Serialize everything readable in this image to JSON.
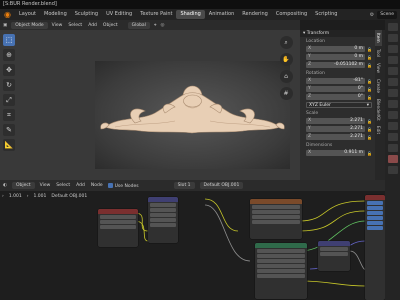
{
  "window": {
    "title": "[S:BUR Render.blend]"
  },
  "menubar": {
    "tabs": [
      "Layout",
      "Modeling",
      "Sculpting",
      "UV Editing",
      "Texture Paint",
      "Shading",
      "Animation",
      "Rendering",
      "Compositing",
      "Scripting"
    ],
    "active_tab": "Shading",
    "scene_label": "Scene"
  },
  "viewport": {
    "mode": "Object Mode",
    "menus": [
      "View",
      "Select",
      "Add",
      "Object"
    ],
    "orientation": "Global"
  },
  "npanel": {
    "transform_title": "Transform",
    "location_label": "Location",
    "location": [
      {
        "axis": "X",
        "value": "0 m"
      },
      {
        "axis": "Y",
        "value": "0 m"
      },
      {
        "axis": "Z",
        "value": "-0.051102 m"
      }
    ],
    "rotation_label": "Rotation",
    "rotation": [
      {
        "axis": "X",
        "value": "-81°"
      },
      {
        "axis": "Y",
        "value": "0°"
      },
      {
        "axis": "Z",
        "value": "0°"
      }
    ],
    "rotation_mode": "XYZ Euler",
    "scale_label": "Scale",
    "scale": [
      {
        "axis": "X",
        "value": "2.271"
      },
      {
        "axis": "Y",
        "value": "2.271"
      },
      {
        "axis": "Z",
        "value": "2.271"
      }
    ],
    "dimensions_label": "Dimensions",
    "dimensions": [
      {
        "axis": "X",
        "value": "0.911 m"
      }
    ],
    "tabs": [
      "Item",
      "Tool",
      "View",
      "Create",
      "BlenderKit",
      "Edit"
    ],
    "active_tab": "Item"
  },
  "node_editor": {
    "type_menu": "Object",
    "menus": [
      "View",
      "Select",
      "Add",
      "Node"
    ],
    "use_nodes_label": "Use Nodes",
    "slot": "Slot 1",
    "material": "Default OBJ.001",
    "crumb_values": [
      "1.001",
      "1.001"
    ],
    "crumb_material": "Default OBJ.001"
  }
}
